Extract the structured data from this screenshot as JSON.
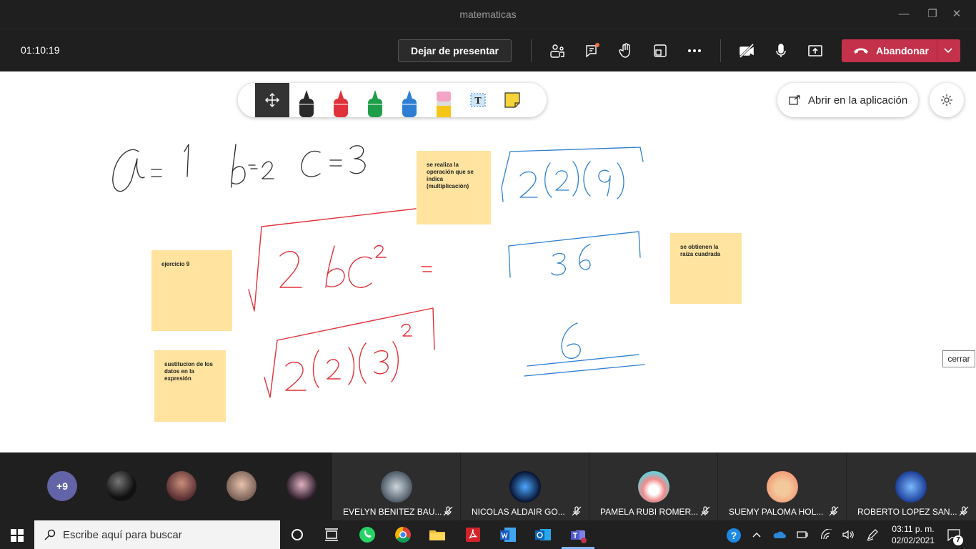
{
  "window": {
    "title": "matematicas"
  },
  "meeting": {
    "timer": "01:10:19",
    "stop_presenting": "Dejar de presentar",
    "leave": "Abandonar"
  },
  "whiteboard": {
    "open_in_app": "Abrir en la aplicación",
    "close_tip": "cerrar",
    "notes": [
      {
        "text": "se realiza la operación que se indica (multiplicación)",
        "color": "#ffe39f"
      },
      {
        "text": "ejercicio 9",
        "color": "#ffe39f"
      },
      {
        "text": "sustitucion de los datos en la expresión",
        "color": "#ffe39f"
      },
      {
        "text": "se obtienen la raiza cuadrada",
        "color": "#ffe39f"
      }
    ],
    "ink_colors": {
      "black": "#2a2a2a",
      "red": "#e0323a",
      "blue": "#2e7fd1"
    }
  },
  "participants": {
    "overflow_count": "+9",
    "tiles": [
      {
        "name": "EVELYN BENITEZ BAU..."
      },
      {
        "name": "NICOLAS ALDAIR GO..."
      },
      {
        "name": "PAMELA RUBI ROMER..."
      },
      {
        "name": "SUEMY PALOMA HOL..."
      },
      {
        "name": "ROBERTO LOPEZ SAN..."
      }
    ]
  },
  "taskbar": {
    "search_placeholder": "Escribe aquí para buscar",
    "time": "03:11 p. m.",
    "date": "02/02/2021",
    "notification_count": "7"
  },
  "colors": {
    "accent_leave": "#c4314b",
    "teams_purple": "#6264a7",
    "note_yellow": "#ffe39f"
  }
}
